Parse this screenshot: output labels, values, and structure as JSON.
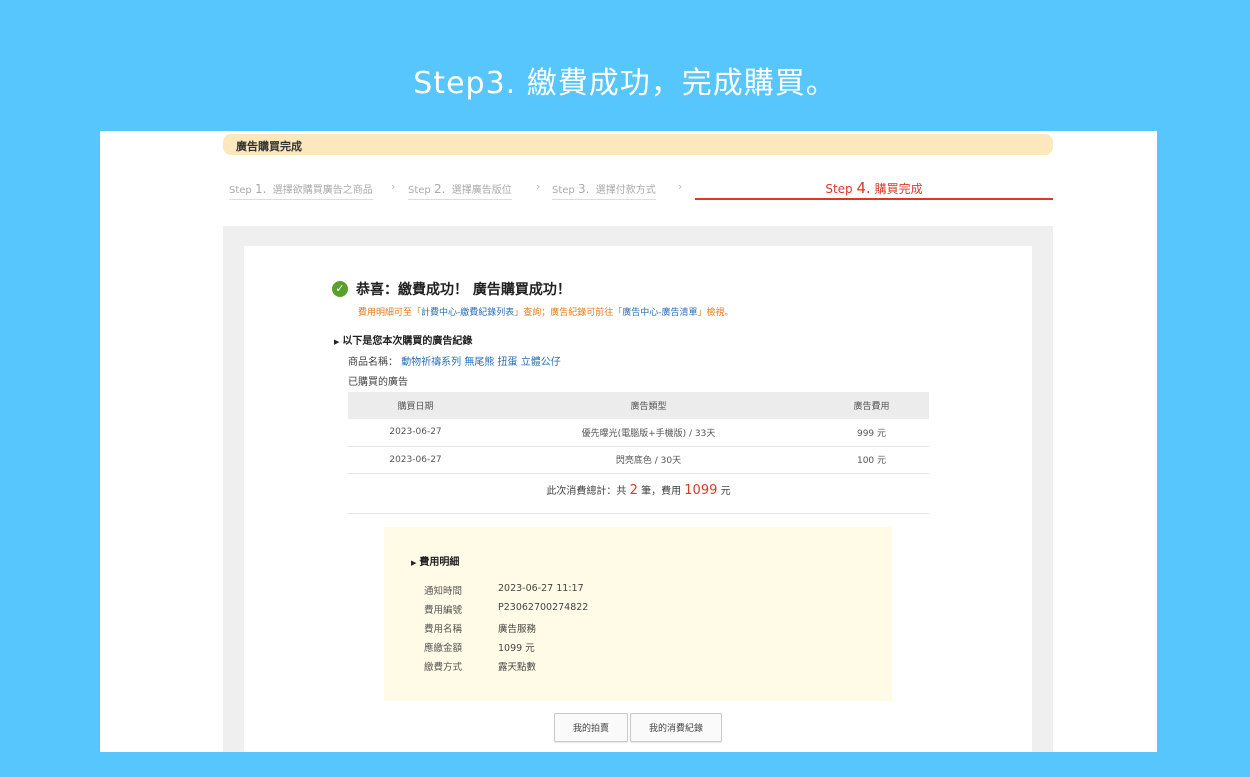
{
  "hero": {
    "title": "Step3. 繳費成功，完成購買。"
  },
  "header": {
    "title": "廣告購買完成"
  },
  "steps": [
    {
      "label": "Step",
      "num": "1.",
      "text": "選擇欲購買廣告之商品"
    },
    {
      "label": "Step",
      "num": "2.",
      "text": "選擇廣告版位"
    },
    {
      "label": "Step",
      "num": "3.",
      "text": "選擇付款方式"
    },
    {
      "label": "Step",
      "num": "4.",
      "text": "購買完成"
    }
  ],
  "success": {
    "title": "恭喜：繳費成功！ 廣告購買成功！",
    "note_pre": "費用明細可至「",
    "note_link1": "計費中心-繳費紀錄列表",
    "note_mid": "」查詢；廣告紀錄可前往「",
    "note_link2": "廣告中心-廣告清單",
    "note_post": "」檢視。"
  },
  "record": {
    "heading": "以下是您本次購買的廣告紀錄",
    "product_label": "商品名稱：",
    "product_name": "動物祈禱系列 無尾熊 扭蛋 立體公仔",
    "bought_label": "已購買的廣告",
    "columns": [
      "購買日期",
      "廣告類型",
      "廣告費用"
    ],
    "rows": [
      {
        "date": "2023-06-27",
        "type": "優先曝光(電腦版+手機版) / 33天",
        "fee": "999  元"
      },
      {
        "date": "2023-06-27",
        "type": "閃亮底色 / 30天",
        "fee": "100  元"
      }
    ],
    "total_pre": "此次消費總計：共",
    "total_count": "2",
    "total_mid": "筆，費用",
    "total_amount": "1099",
    "total_unit": "元"
  },
  "fee_detail": {
    "heading": "費用明細",
    "rows": [
      {
        "k": "通知時間",
        "v": "2023-06-27 11:17"
      },
      {
        "k": "費用編號",
        "v": "P23062700274822"
      },
      {
        "k": "費用名稱",
        "v": "廣告服務"
      },
      {
        "k": "應繳金額",
        "v": "1099 元"
      },
      {
        "k": "繳費方式",
        "v": "露天點數"
      }
    ]
  },
  "buttons": {
    "my_auctions": "我的拍賣",
    "my_spending": "我的消費紀錄"
  },
  "colors": {
    "background": "#57c6fd",
    "accent_red": "#d9392b",
    "link_blue": "#2a6fb5",
    "success_green": "#5aa02c"
  }
}
